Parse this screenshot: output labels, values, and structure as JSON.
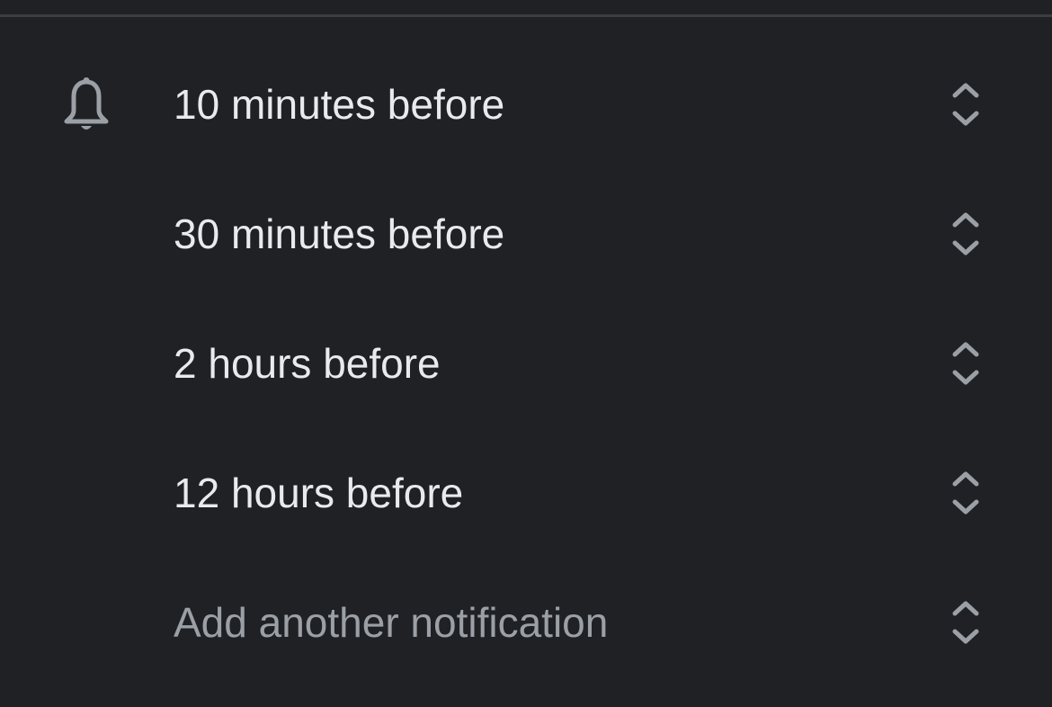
{
  "colors": {
    "background": "#202124",
    "divider": "#3c3d40",
    "text_primary": "#e8eaed",
    "text_muted": "#9aa0a6",
    "icon": "#9aa0a6"
  },
  "icons": {
    "header": "bell-icon",
    "stepper": "up-down-chevron-icon"
  },
  "notifications": [
    {
      "label": "10 minutes before"
    },
    {
      "label": "30 minutes before"
    },
    {
      "label": "2 hours before"
    },
    {
      "label": "12 hours before"
    }
  ],
  "add_notification": {
    "label": "Add another notification"
  }
}
